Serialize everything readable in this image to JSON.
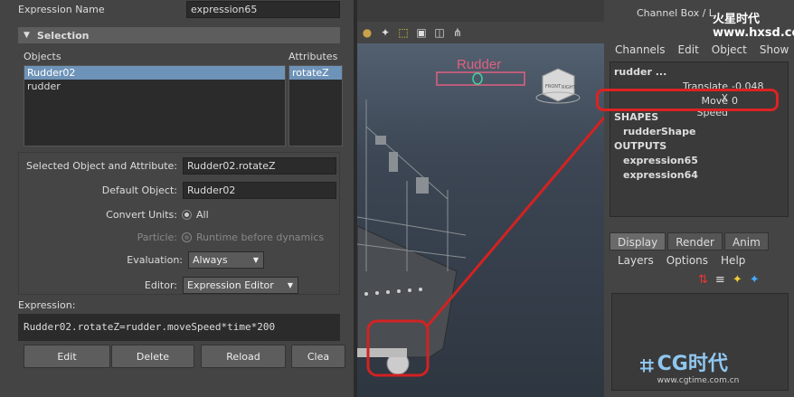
{
  "expression_editor": {
    "expression_name_label": "Expression Name",
    "expression_name_value": "expression65",
    "section_title": "Selection",
    "objects_label": "Objects",
    "attributes_label": "Attributes",
    "objects": [
      "Rudder02",
      "rudder"
    ],
    "attributes": [
      "rotateZ"
    ],
    "selected_obj_attr_label": "Selected Object and Attribute:",
    "selected_obj_attr_value": "Rudder02.rotateZ",
    "default_object_label": "Default Object:",
    "default_object_value": "Rudder02",
    "convert_units_label": "Convert Units:",
    "convert_units_option": "All",
    "particle_label": "Particle:",
    "particle_option": "Runtime before dynamics",
    "evaluation_label": "Evaluation:",
    "evaluation_value": "Always",
    "editor_label": "Editor:",
    "editor_value": "Expression Editor",
    "expression_label": "Expression:",
    "expression_text": "Rudder02.rotateZ=rudder.moveSpeed*time*200",
    "buttons": [
      "Edit",
      "Delete",
      "Reload",
      "Clea"
    ]
  },
  "viewport": {
    "object_label": "Rudder",
    "cube_labels": [
      "FRONT",
      "RIGHT"
    ]
  },
  "channel_box": {
    "title": "Channel Box / L",
    "watermark": "火星时代 www.hxsd.com",
    "menu": [
      "Channels",
      "Edit",
      "Object",
      "Show"
    ],
    "object_name": "rudder ...",
    "translate_x_label": "Translate X",
    "translate_x_value": "-0.048",
    "move_speed_label": "Move Speed",
    "move_speed_value": "0",
    "shapes_label": "SHAPES",
    "shape_name": "rudderShape",
    "outputs_label": "OUTPUTS",
    "outputs": [
      "expression65",
      "expression64"
    ],
    "tabs": [
      "Display",
      "Render",
      "Anim"
    ],
    "layer_menu": [
      "Layers",
      "Options",
      "Help"
    ],
    "logo_text": "CG时代",
    "logo_url": "www.cgtime.com.cn"
  },
  "colors": {
    "highlight": "#d22222",
    "selection": "#6e93b8"
  }
}
